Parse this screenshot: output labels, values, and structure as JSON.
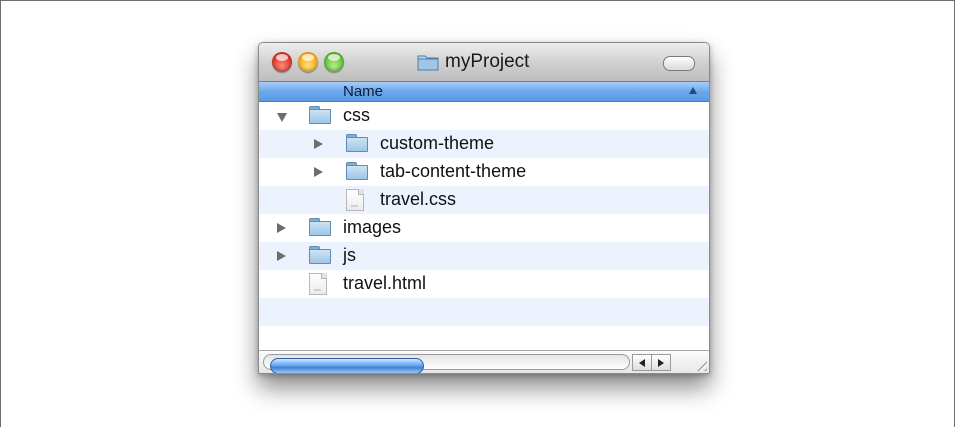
{
  "window": {
    "title": "myProject",
    "title_icon": "folder-icon"
  },
  "column": {
    "name_label": "Name",
    "sort": "ascending"
  },
  "rows": [
    {
      "label": "css",
      "kind": "folder",
      "disclosure": "expanded",
      "depth": 0
    },
    {
      "label": "custom-theme",
      "kind": "folder",
      "disclosure": "collapsed",
      "depth": 1
    },
    {
      "label": "tab-content-theme",
      "kind": "folder",
      "disclosure": "collapsed",
      "depth": 1
    },
    {
      "label": "travel.css",
      "kind": "file",
      "disclosure": "none",
      "depth": 1
    },
    {
      "label": "images",
      "kind": "folder",
      "disclosure": "collapsed",
      "depth": 0
    },
    {
      "label": "js",
      "kind": "folder",
      "disclosure": "collapsed",
      "depth": 0
    },
    {
      "label": "travel.html",
      "kind": "file",
      "disclosure": "none",
      "depth": 0
    }
  ],
  "colors": {
    "header_blue": "#6aa8ee",
    "alt_row": "#edf3fe",
    "close": "#d72b1e",
    "minimize": "#f0a512",
    "zoom": "#56b72a"
  }
}
